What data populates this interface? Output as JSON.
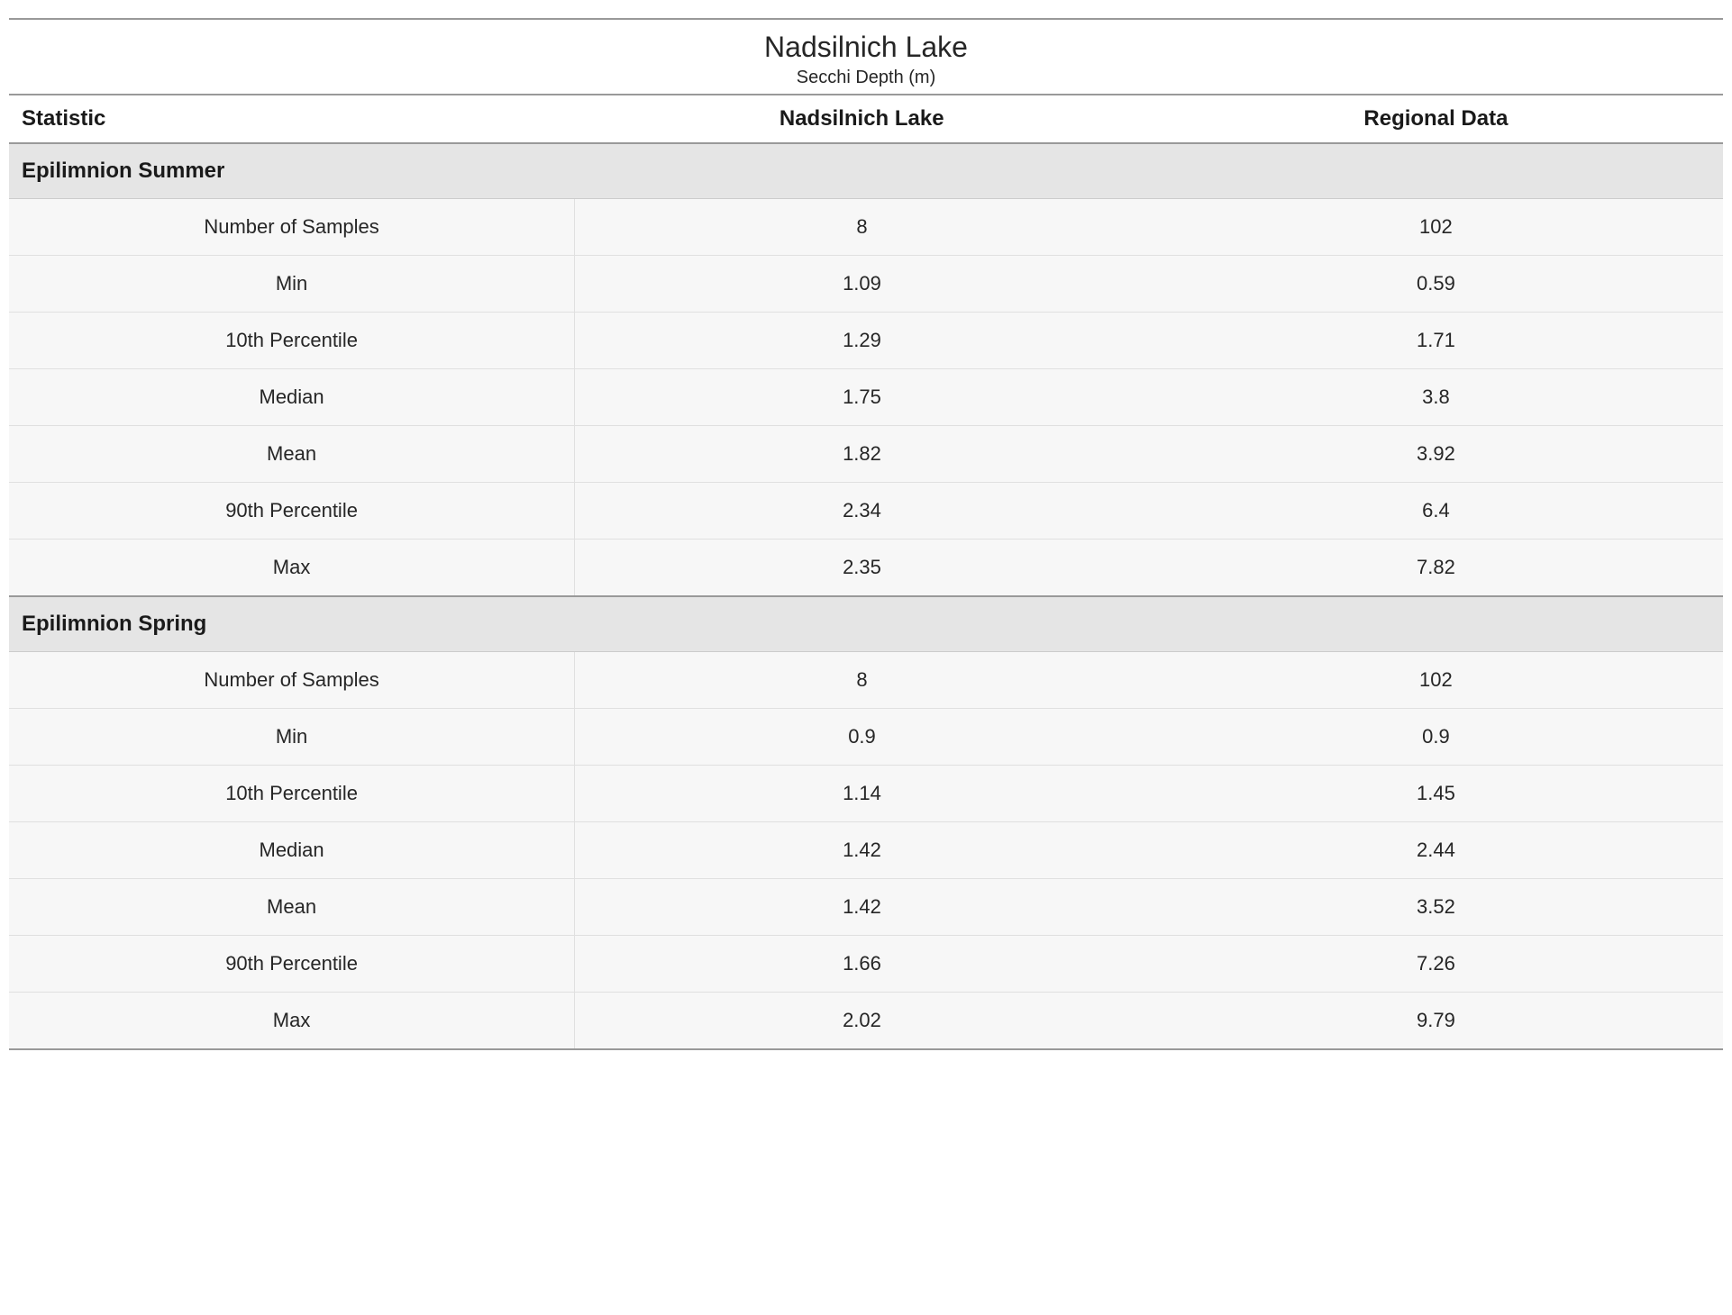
{
  "title": {
    "lake_name": "Nadsilnich Lake",
    "subtitle": "Secchi Depth (m)"
  },
  "headers": {
    "statistic": "Statistic",
    "col1": "Nadsilnich Lake",
    "col2": "Regional Data"
  },
  "sections": [
    {
      "name": "Epilimnion Summer",
      "rows": [
        {
          "stat": "Number of Samples",
          "v1": "8",
          "v2": "102"
        },
        {
          "stat": "Min",
          "v1": "1.09",
          "v2": "0.59"
        },
        {
          "stat": "10th Percentile",
          "v1": "1.29",
          "v2": "1.71"
        },
        {
          "stat": "Median",
          "v1": "1.75",
          "v2": "3.8"
        },
        {
          "stat": "Mean",
          "v1": "1.82",
          "v2": "3.92"
        },
        {
          "stat": "90th Percentile",
          "v1": "2.34",
          "v2": "6.4"
        },
        {
          "stat": "Max",
          "v1": "2.35",
          "v2": "7.82"
        }
      ]
    },
    {
      "name": "Epilimnion Spring",
      "rows": [
        {
          "stat": "Number of Samples",
          "v1": "8",
          "v2": "102"
        },
        {
          "stat": "Min",
          "v1": "0.9",
          "v2": "0.9"
        },
        {
          "stat": "10th Percentile",
          "v1": "1.14",
          "v2": "1.45"
        },
        {
          "stat": "Median",
          "v1": "1.42",
          "v2": "2.44"
        },
        {
          "stat": "Mean",
          "v1": "1.42",
          "v2": "3.52"
        },
        {
          "stat": "90th Percentile",
          "v1": "1.66",
          "v2": "7.26"
        },
        {
          "stat": "Max",
          "v1": "2.02",
          "v2": "9.79"
        }
      ]
    }
  ]
}
